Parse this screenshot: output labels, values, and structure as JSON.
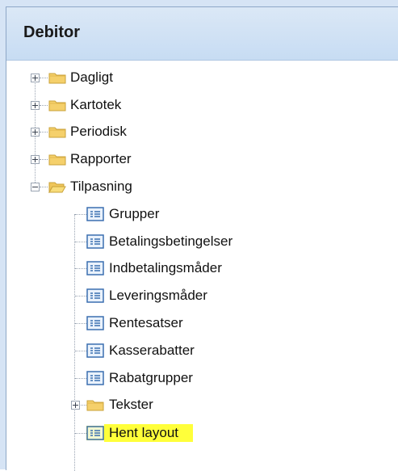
{
  "header": {
    "title": "Debitor"
  },
  "tree": {
    "folders": [
      {
        "label": "Dagligt",
        "expanded": false
      },
      {
        "label": "Kartotek",
        "expanded": false
      },
      {
        "label": "Periodisk",
        "expanded": false
      },
      {
        "label": "Rapporter",
        "expanded": false
      },
      {
        "label": "Tilpasning",
        "expanded": true
      }
    ],
    "children": [
      {
        "label": "Grupper",
        "type": "form"
      },
      {
        "label": "Betalingsbetingelser",
        "type": "form"
      },
      {
        "label": "Indbetalingsmåder",
        "type": "form"
      },
      {
        "label": "Leveringsmåder",
        "type": "form"
      },
      {
        "label": "Rentesatser",
        "type": "form"
      },
      {
        "label": "Kasserabatter",
        "type": "form"
      },
      {
        "label": "Rabatgrupper",
        "type": "form"
      },
      {
        "label": "Tekster",
        "type": "folder",
        "expanded": false
      },
      {
        "label": "Hent layout",
        "type": "form",
        "selected": true
      }
    ]
  },
  "colors": {
    "selection": "#ffff3a",
    "header_bg": "#c7dcf3",
    "folder": "#f2c94c",
    "form_icon": "#3b6fb0"
  }
}
